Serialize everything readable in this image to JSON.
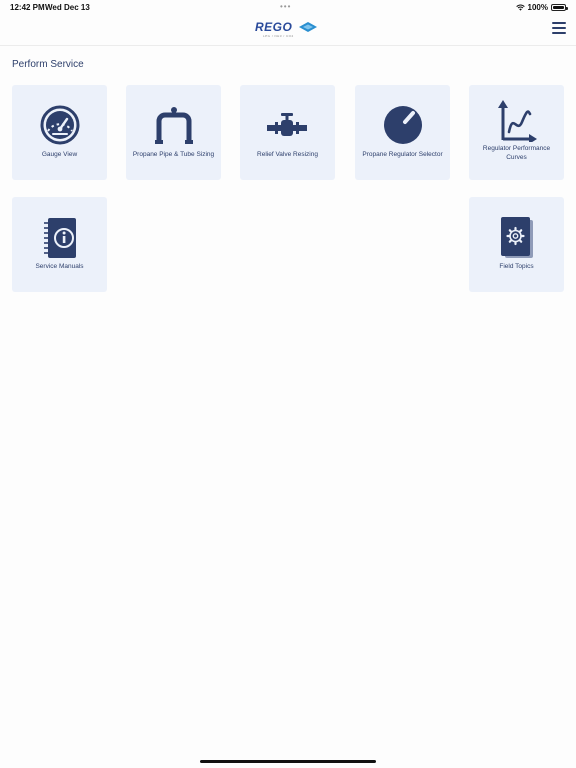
{
  "status": {
    "time": "12:42 PM",
    "date": "Wed Dec 13",
    "dots": "•••",
    "battery": "100%"
  },
  "header": {
    "logo_text": "REGO",
    "logo_tagline": "LPG / NH3 / CO2"
  },
  "page": {
    "section_title": "Perform Service"
  },
  "cards": [
    {
      "label": "Gauge View",
      "icon": "gauge-icon"
    },
    {
      "label": "Propane Pipe & Tube Sizing",
      "icon": "pipe-icon"
    },
    {
      "label": "Relief Valve Resizing",
      "icon": "valve-icon"
    },
    {
      "label": "Propane Regulator Selector",
      "icon": "regulator-dial-icon"
    },
    {
      "label": "Regulator Performance Curves",
      "icon": "curve-chart-icon"
    },
    {
      "label": "Service Manuals",
      "icon": "manual-book-icon"
    },
    {
      "label": "Field Topics",
      "icon": "settings-book-icon"
    }
  ],
  "colors": {
    "accent": "#2d3f6b",
    "card_bg": "#ecf1fa"
  }
}
